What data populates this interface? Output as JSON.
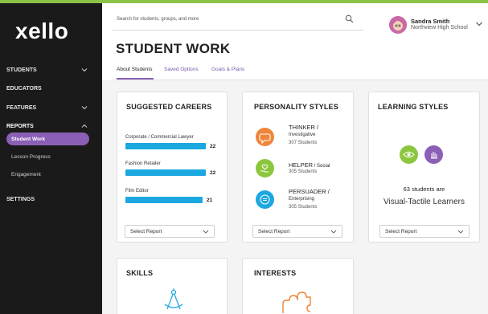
{
  "app": {
    "logo": "xello"
  },
  "colors": {
    "accent": "#8a5fb5",
    "bar": "#1ba8e0",
    "sidebar": "#1a1a1a",
    "topline": "#8bc34a"
  },
  "sidebar": {
    "items": [
      {
        "label": "STUDENTS",
        "chevron": "down"
      },
      {
        "label": "EDUCATORS"
      },
      {
        "label": "FEATURES",
        "chevron": "down"
      },
      {
        "label": "REPORTS",
        "chevron": "up"
      },
      {
        "label": "SETTINGS"
      }
    ],
    "sub_items": [
      {
        "label": "Student Work",
        "active": true
      },
      {
        "label": "Lesson Progress"
      },
      {
        "label": "Engagement"
      }
    ]
  },
  "header": {
    "search_placeholder": "Search for students, groups, and more",
    "user_name": "Sandra Smith",
    "user_school": "Northview High School"
  },
  "page": {
    "title": "STUDENT WORK"
  },
  "tabs": [
    {
      "label": "About Students",
      "active": true
    },
    {
      "label": "Saved Options"
    },
    {
      "label": "Goals & Plans"
    }
  ],
  "cards": {
    "suggested_careers": {
      "title": "SUGGESTED CAREERS",
      "items": [
        {
          "label": "Corporate / Commercial Lawyer",
          "value": "22",
          "fraction": 1.0
        },
        {
          "label": "Fashion Retailer",
          "value": "22",
          "fraction": 1.0
        },
        {
          "label": "Film Editor",
          "value": "21",
          "fraction": 0.955
        }
      ],
      "select_label": "Select Report"
    },
    "personality_styles": {
      "title": "PERSONALITY STYLES",
      "items": [
        {
          "name": "THINKER /",
          "type": "Investigative",
          "count": "307 Students",
          "color": "#f0853a",
          "icon": "chat-bubble-icon"
        },
        {
          "name": "HELPER",
          "name_suffix": " / Social",
          "type": "",
          "count": "305 Students",
          "color": "#8cc63f",
          "icon": "heart-hand-icon"
        },
        {
          "name": "PERSUADER /",
          "type": "Enterprising",
          "count": "305 Students",
          "color": "#1ba8e0",
          "icon": "speech-icon"
        }
      ],
      "select_label": "Select Report"
    },
    "learning_styles": {
      "title": "LEARNING STYLES",
      "count": "63 students are",
      "type": "Visual-Tactile Learners",
      "icons": [
        {
          "name": "eye-icon",
          "color": "#8cc63f"
        },
        {
          "name": "hand-icon",
          "color": "#8a5fb5"
        }
      ],
      "select_label": "Select Report"
    },
    "skills": {
      "title": "SKILLS"
    },
    "interests": {
      "title": "INTERESTS"
    }
  }
}
